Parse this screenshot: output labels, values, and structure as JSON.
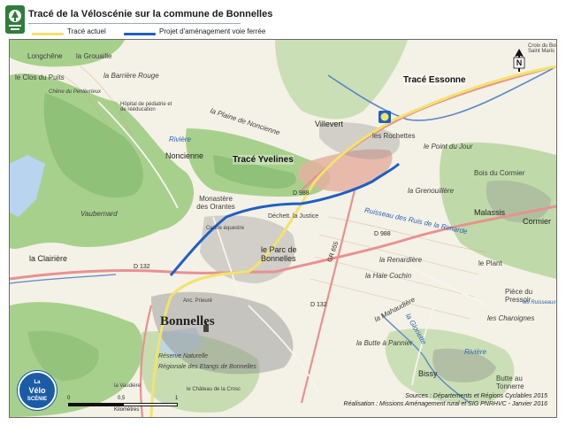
{
  "header": {
    "title": "Tracé de la Véloscénie sur la commune de Bonnelles",
    "legend": [
      {
        "label": "Tracé actuel",
        "color": "#f2e36b"
      },
      {
        "label": "Projet d'aménagement voie ferrée",
        "color": "#1f5fc4"
      }
    ]
  },
  "map": {
    "colors": {
      "background": "#f4f1e6",
      "forest": "#a8d08d",
      "forest_dark": "#7fb86a",
      "urban": "#8f8f8f",
      "river": "#5a88c8",
      "road_major": "#e89191",
      "road_minor": "#f7f5ef",
      "trace_current": "#f2e36b",
      "trace_project": "#1f5fc4",
      "project_zone": "#e5b0a0"
    },
    "trace_labels": {
      "essonne": "Tracé Essonne",
      "yvelines": "Tracé Yvelines"
    },
    "places": [
      {
        "text": "Longchêne"
      },
      {
        "text": "la Grouaille"
      },
      {
        "text": "le Clos du Puits"
      },
      {
        "text": "Chêne du Penlèvrieux"
      },
      {
        "text": "la Barrière Rouge"
      },
      {
        "text": "Hôpital de pédiatrie et de rééducation"
      },
      {
        "text": "la Plaine de Noncienne"
      },
      {
        "text": "Noncienne"
      },
      {
        "text": "Villevert"
      },
      {
        "text": "les Rochettes"
      },
      {
        "text": "le Point du Jour"
      },
      {
        "text": "la Grenouillère"
      },
      {
        "text": "Bois du Cormier"
      },
      {
        "text": "Malassis"
      },
      {
        "text": "Cormier"
      },
      {
        "text": "Monastère des Orantes"
      },
      {
        "text": "Déchett. la Justice"
      },
      {
        "text": "Centre équestre"
      },
      {
        "text": "Vaubernard"
      },
      {
        "text": "la Clairière"
      },
      {
        "text": "le Parc de Bonnelles"
      },
      {
        "text": "la Renardière"
      },
      {
        "text": "la Haie Cochin"
      },
      {
        "text": "la Mahaudière"
      },
      {
        "text": "le Plant"
      },
      {
        "text": "Pièce du Pressoir"
      },
      {
        "text": "les Charoignes"
      },
      {
        "text": "la Butte à Pannier"
      },
      {
        "text": "Bonnelles"
      },
      {
        "text": "Bissy"
      },
      {
        "text": "Butte au Tonnerre"
      },
      {
        "text": "Croix du Bois Saint Maris"
      },
      {
        "text": "Anc. Prieuré"
      },
      {
        "text": "Réserve Naturelle"
      },
      {
        "text": "Régionale des Etangs de Bonnelles"
      },
      {
        "text": "la Vaudière"
      },
      {
        "text": "le Château de la Crnsc"
      }
    ],
    "roads": [
      {
        "text": "D 132"
      },
      {
        "text": "D 132"
      },
      {
        "text": "D 988"
      },
      {
        "text": "GR 655"
      },
      {
        "text": "D 988"
      }
    ],
    "water": [
      {
        "text": "Rivière"
      },
      {
        "text": "la Gloriette"
      },
      {
        "text": "Rivière"
      },
      {
        "text": "Ruisseau des Ruis de la Rimarde"
      },
      {
        "text": "les Ruisseaux"
      }
    ],
    "north_label": "N",
    "badge_lines": [
      "La",
      "Vélo",
      "SCÉNIE"
    ],
    "scale": {
      "ticks": [
        "0",
        "0,5",
        "1"
      ],
      "unit": "Kilomètres"
    },
    "sources": [
      "Sources : Départements et Régions Cyclables 2015",
      "Réalisation : Missions Aménagement rural et SIG PNRHVC - Janvier 2016"
    ]
  }
}
